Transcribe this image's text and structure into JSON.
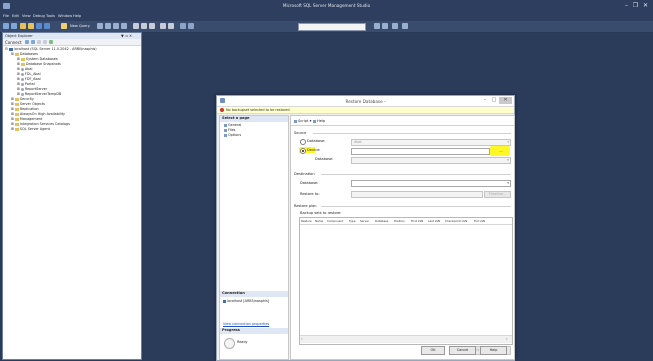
{
  "window": {
    "title": "Microsoft SQL Server Management Studio",
    "minimize": "–",
    "restore": "❐",
    "close": "✕"
  },
  "menu": [
    "File",
    "Edit",
    "View",
    "Debug",
    "Tools",
    "Window",
    "Help"
  ],
  "toolbar": {
    "new_query": "New Query",
    "database_dropdown": ""
  },
  "object_explorer": {
    "title": "Object Explorer",
    "pin": "▼ ⊐ ✕",
    "connect": "Connect",
    "server": "localhost (SQL Server 11.0.2042 - ARBI\\Inasphis)",
    "items": [
      {
        "label": "Databases",
        "level": 1,
        "icon": "folder"
      },
      {
        "label": "System Databases",
        "level": 2,
        "icon": "folder"
      },
      {
        "label": "Database Snapshots",
        "level": 2,
        "icon": "folder"
      },
      {
        "label": "Abal",
        "level": 2,
        "icon": "db"
      },
      {
        "label": "FDL_Abal",
        "level": 2,
        "icon": "db"
      },
      {
        "label": "FDF_Abal",
        "level": 2,
        "icon": "db"
      },
      {
        "label": "Portal",
        "level": 2,
        "icon": "db"
      },
      {
        "label": "ReportServer",
        "level": 2,
        "icon": "db"
      },
      {
        "label": "ReportServerTempDB",
        "level": 2,
        "icon": "db"
      },
      {
        "label": "Security",
        "level": 1,
        "icon": "folder"
      },
      {
        "label": "Server Objects",
        "level": 1,
        "icon": "folder"
      },
      {
        "label": "Replication",
        "level": 1,
        "icon": "folder"
      },
      {
        "label": "AlwaysOn High Availability",
        "level": 1,
        "icon": "folder"
      },
      {
        "label": "Management",
        "level": 1,
        "icon": "folder"
      },
      {
        "label": "Integration Services Catalogs",
        "level": 1,
        "icon": "folder"
      },
      {
        "label": "SQL Server Agent",
        "level": 1,
        "icon": "folder"
      }
    ]
  },
  "dialog": {
    "title": "Restore Database -",
    "warning": "No backupset selected to be restored.",
    "select_page": "Select a page",
    "pages": [
      "General",
      "Files",
      "Options"
    ],
    "script": "Script",
    "help": "Help",
    "source": "Source",
    "database_radio": "Database:",
    "database_value": "Abal",
    "device_radio": "Device:",
    "browse": "...",
    "database_label": "Database:",
    "destination": "Destination",
    "dest_database_label": "Database:",
    "restore_to_label": "Restore to:",
    "timeline": "Timeline...",
    "restore_plan": "Restore plan",
    "backup_sets": "Backup sets to restore:",
    "columns": [
      "Restore",
      "Name",
      "Component",
      "Type",
      "Server",
      "Database",
      "Position",
      "First LSN",
      "Last LSN",
      "Checkpoint LSN",
      "Full LSN"
    ],
    "verify_button": "Verify Backup Media",
    "connection_head": "Connection",
    "connection_value": "localhost [ARBI\\Inasphis]",
    "view_connection": "View connection properties",
    "progress_head": "Progress",
    "progress_status": "Ready",
    "ok": "OK",
    "cancel": "Cancel",
    "help_btn": "Help"
  }
}
